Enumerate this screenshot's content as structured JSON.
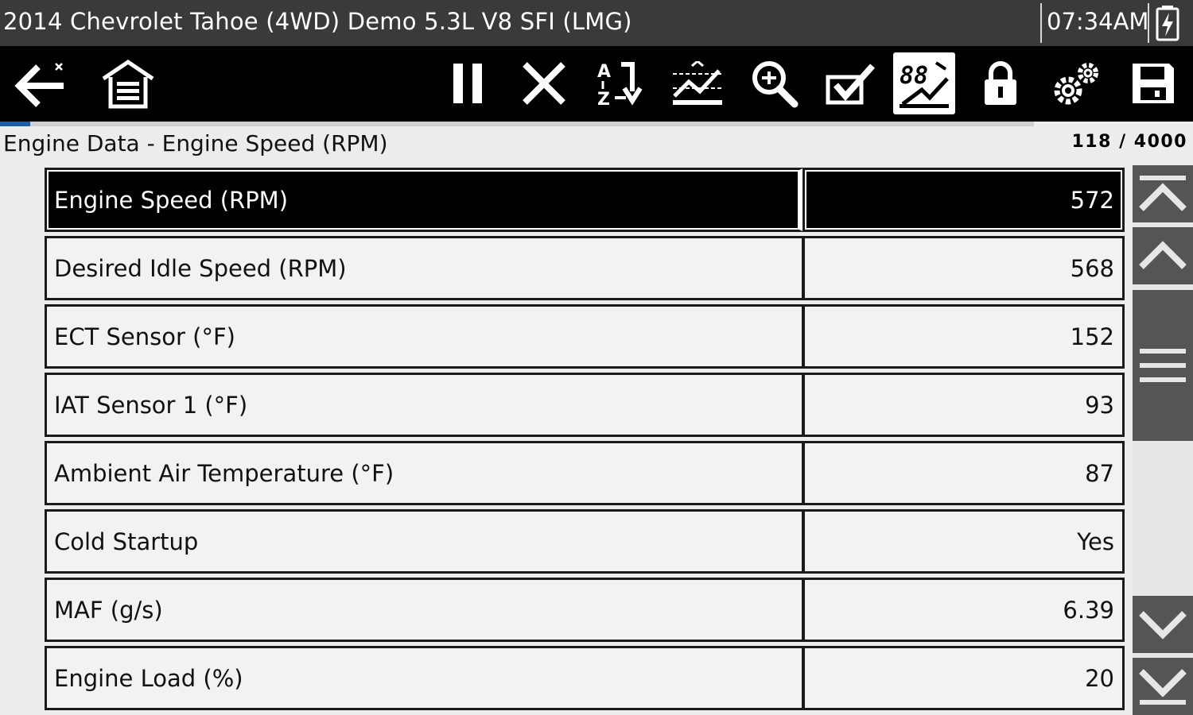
{
  "titlebar": {
    "vehicle": "2014 Chevrolet Tahoe (4WD) Demo 5.3L V8 SFI (LMG)",
    "clock": "07:34AM",
    "battery_icon": "battery-charging-icon"
  },
  "toolbar": {
    "buttons": [
      {
        "id": "back",
        "icon": "back-arrow-icon"
      },
      {
        "id": "home",
        "icon": "home-garage-icon"
      },
      {
        "id": "pause",
        "icon": "pause-icon"
      },
      {
        "id": "close",
        "icon": "close-icon"
      },
      {
        "id": "sort",
        "icon": "sort-az-icon"
      },
      {
        "id": "graph",
        "icon": "graph-view-icon"
      },
      {
        "id": "zoom",
        "icon": "zoom-icon"
      },
      {
        "id": "select",
        "icon": "checkmark-icon"
      },
      {
        "id": "pid-view",
        "icon": "digital-gauge-icon",
        "active": true
      },
      {
        "id": "lock",
        "icon": "lock-icon"
      },
      {
        "id": "settings",
        "icon": "gears-icon"
      },
      {
        "id": "save",
        "icon": "save-icon"
      }
    ],
    "buffer_progress": 0.0295
  },
  "page": {
    "title": "Engine Data - Engine Speed (RPM)",
    "counter": "118 / 4000"
  },
  "rows": [
    {
      "name": "Engine Speed (RPM)",
      "value": "572",
      "selected": true
    },
    {
      "name": "Desired Idle Speed (RPM)",
      "value": "568"
    },
    {
      "name": "ECT Sensor (°F)",
      "value": "152"
    },
    {
      "name": "IAT Sensor 1 (°F)",
      "value": "93"
    },
    {
      "name": "Ambient Air Temperature (°F)",
      "value": "87"
    },
    {
      "name": "Cold Startup",
      "value": "Yes"
    },
    {
      "name": "MAF (g/s)",
      "value": "6.39"
    },
    {
      "name": "Engine Load (%)",
      "value": "20"
    }
  ],
  "scroll": {
    "icons": [
      "scroll-top-icon",
      "scroll-up-icon",
      "scroll-thumb-grip-icon",
      "scroll-down-icon",
      "scroll-bottom-icon"
    ]
  }
}
